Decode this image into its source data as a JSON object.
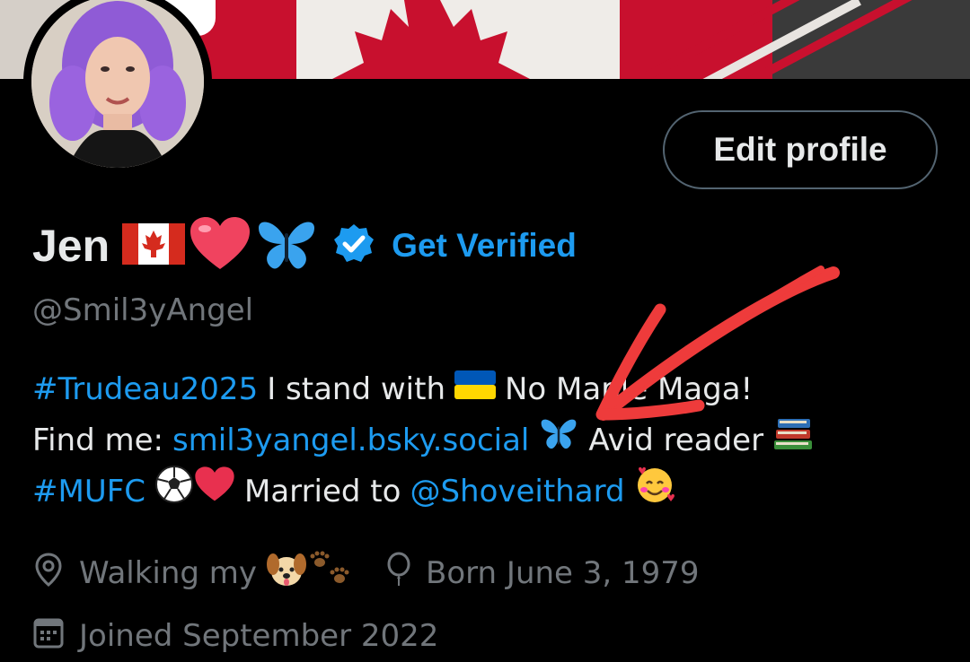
{
  "profile": {
    "display_name": "Jen",
    "get_verified_label": "Get Verified",
    "handle": "@Smil3yAngel",
    "edit_profile_label": "Edit profile",
    "name_emojis": [
      "canada-flag-icon",
      "red-heart-icon",
      "butterfly-icon"
    ]
  },
  "bio": {
    "line1": {
      "hashtag": "#Trudeau2025",
      "text_a": "I stand with",
      "text_b": "No Maple Maga!"
    },
    "line2": {
      "text_a": "Find me:",
      "link": "smil3yangel.bsky.social",
      "text_b": "Avid reader"
    },
    "line3": {
      "hashtag": "#MUFC",
      "text_a": "Married to",
      "mention": "@Shoveithard"
    }
  },
  "meta": {
    "location": "Walking my",
    "birthday": "Born June 3, 1979",
    "joined": "Joined September 2022"
  },
  "colors": {
    "background": "#000000",
    "accent": "#1d9bf0",
    "text_primary": "#e7e9ea",
    "text_secondary": "#71767b",
    "annotation_arrow": "#ee3b3b"
  }
}
